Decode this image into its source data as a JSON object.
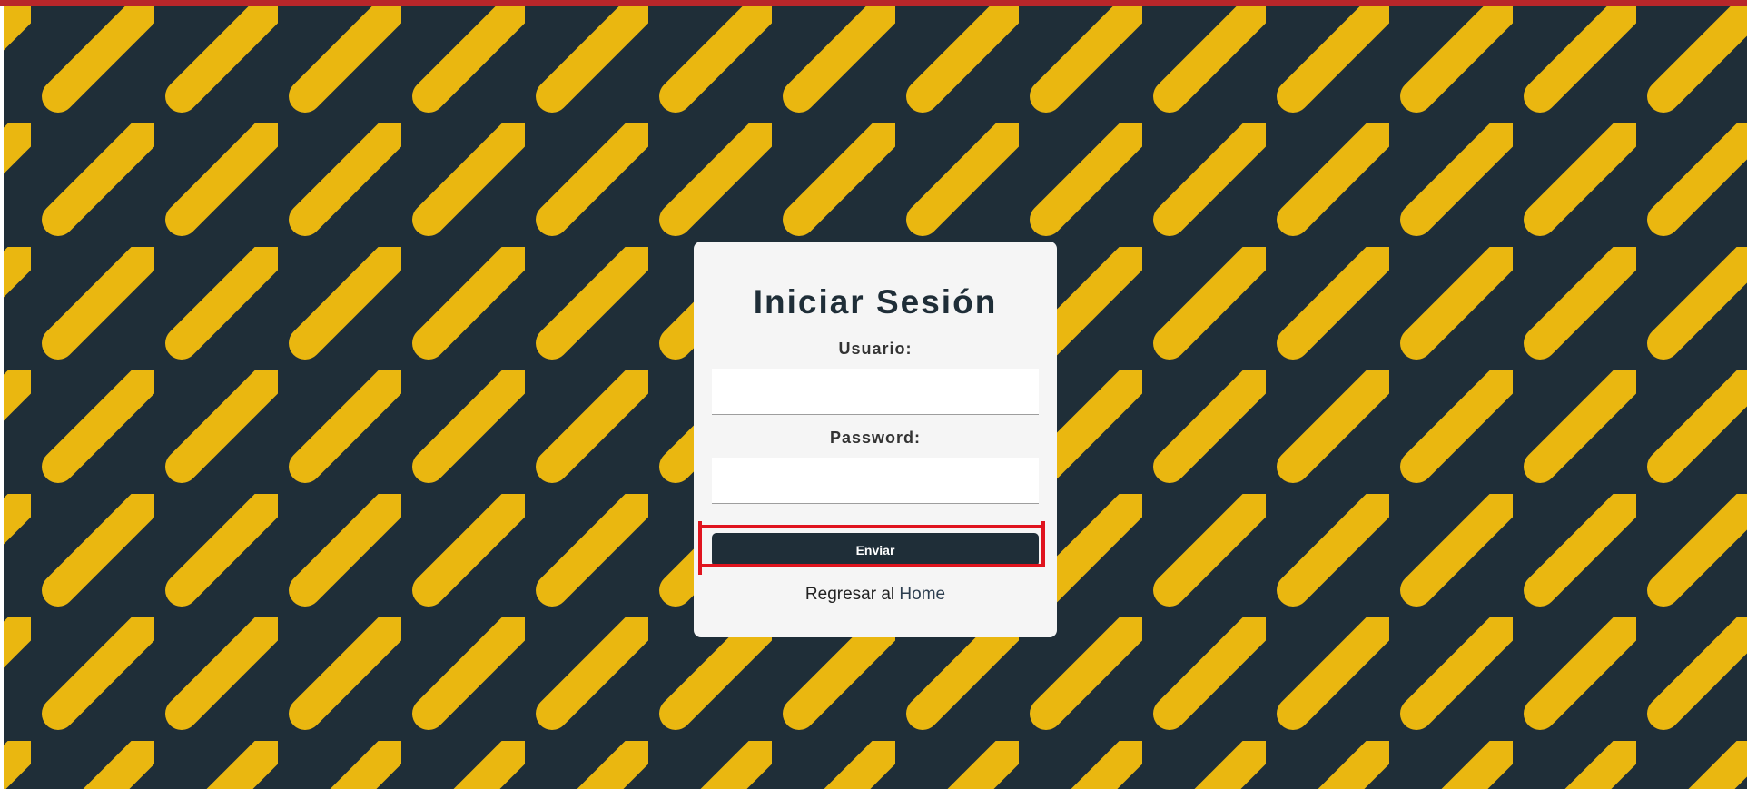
{
  "login": {
    "title": "Iniciar Sesión",
    "username_label": "Usuario:",
    "username_value": "",
    "password_label": "Password:",
    "password_value": "",
    "submit_label": "Enviar",
    "back_text": "Regresar al",
    "back_link": "Home"
  },
  "colors": {
    "background": "#1f2e38",
    "stripe": "#eab710",
    "card": "#f5f5f5",
    "button": "#1f2e38",
    "top_bar": "#b8262a",
    "highlight": "#e0141e"
  }
}
